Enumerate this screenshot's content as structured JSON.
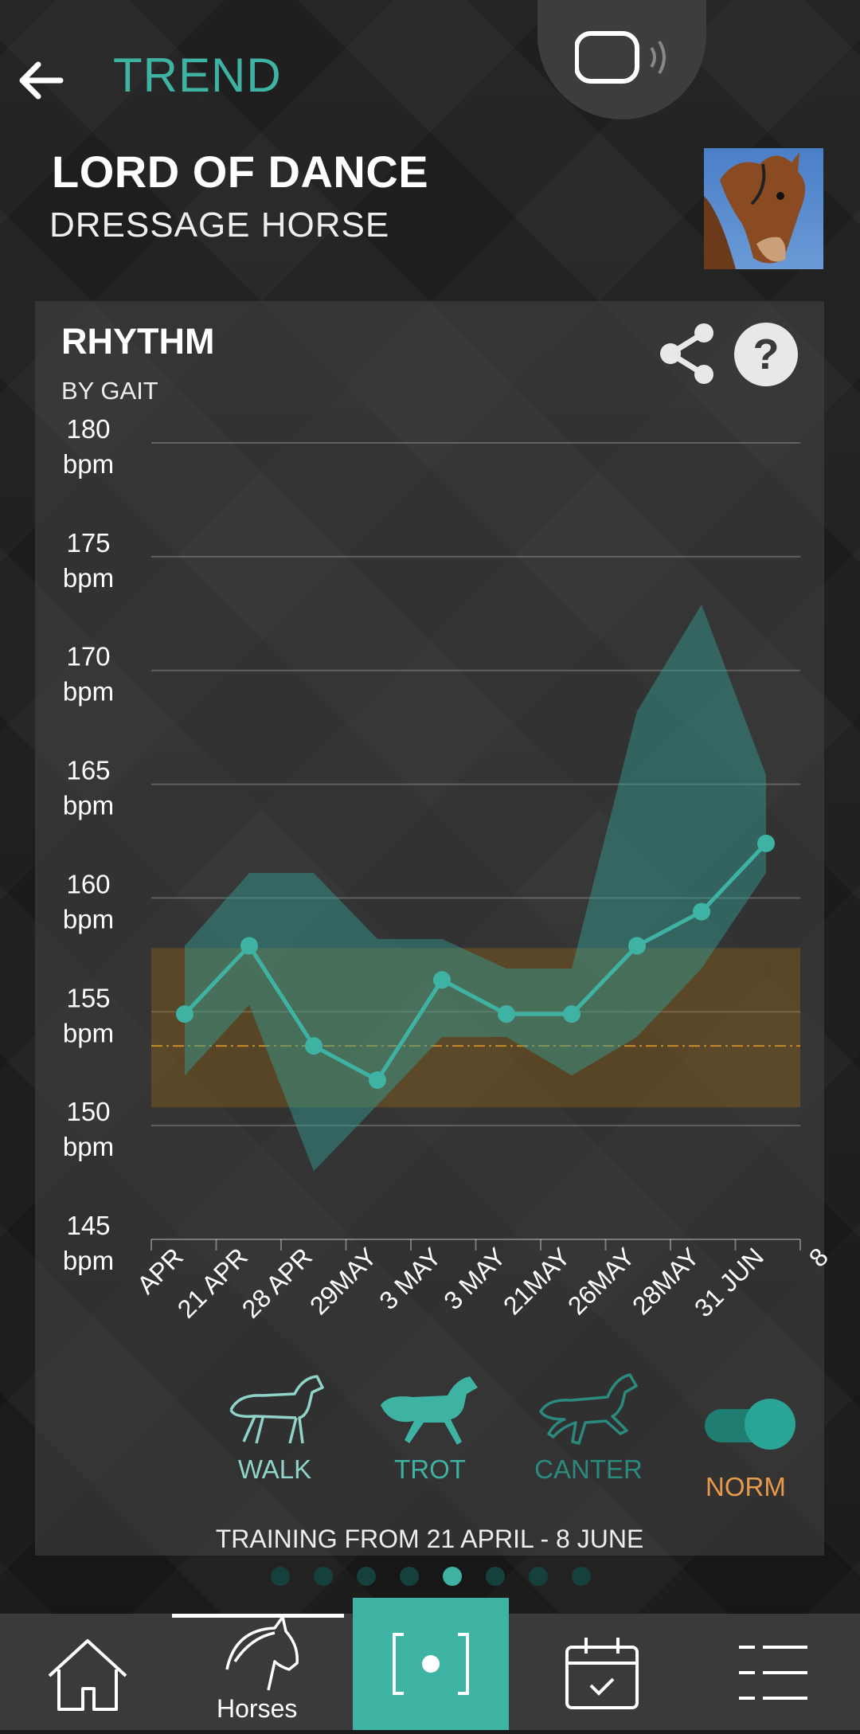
{
  "header": {
    "title": "TREND",
    "horse_name": "LORD OF DANCE",
    "horse_type": "DRESSAGE HORSE"
  },
  "card": {
    "title": "RHYTHM",
    "subtitle": "BY GAIT",
    "help_symbol": "?",
    "training_range": "TRAINING FROM 21 APRIL - 8 JUNE"
  },
  "chart_data": {
    "type": "area",
    "ylim": [
      145,
      180
    ],
    "y_ticks": [
      {
        "value": 180,
        "label": "180",
        "unit": "bpm"
      },
      {
        "value": 175,
        "label": "175",
        "unit": "bpm"
      },
      {
        "value": 170,
        "label": "170",
        "unit": "bpm"
      },
      {
        "value": 165,
        "label": "165",
        "unit": "bpm"
      },
      {
        "value": 160,
        "label": "160",
        "unit": "bpm"
      },
      {
        "value": 155,
        "label": "155",
        "unit": "bpm"
      },
      {
        "value": 150,
        "label": "150",
        "unit": "bpm"
      },
      {
        "value": 145,
        "label": "145",
        "unit": "bpm"
      }
    ],
    "x_tick_labels": [
      "APR",
      "21 APR",
      "28 APR",
      "29MAY",
      "3 MAY",
      "3 MAY",
      "21MAY",
      "26MAY",
      "28MAY",
      "31 JUN",
      "8"
    ],
    "series": [
      {
        "values": [
          154.9,
          157.9,
          153.5,
          152.0,
          156.4,
          154.9,
          154.9,
          157.9,
          159.4,
          162.4
        ],
        "band_upper": [
          157.9,
          161.1,
          161.1,
          158.2,
          158.2,
          156.9,
          156.9,
          168.2,
          172.9,
          165.4
        ],
        "band_lower": [
          152.2,
          155.3,
          148.0,
          150.9,
          153.9,
          153.9,
          152.2,
          153.9,
          156.9,
          161.1
        ],
        "color": "#3fb3a3"
      }
    ],
    "norm": {
      "upper": 157.8,
      "lower": 150.8,
      "center": 153.5,
      "color": "#c58a2a"
    },
    "grid": true
  },
  "gaits": [
    {
      "label": "WALK",
      "color": "#8fd3c9"
    },
    {
      "label": "TROT",
      "color": "#3fb3a3"
    },
    {
      "label": "CANTER",
      "color": "#2a8a7e"
    }
  ],
  "norm_toggle": {
    "label": "NORM",
    "on": true
  },
  "pager": {
    "count": 8,
    "active": 5
  },
  "nav": {
    "items": [
      "home-icon",
      "horses-icon",
      "record-icon",
      "calendar-icon",
      "menu-icon"
    ],
    "horses_label": "Horses"
  }
}
